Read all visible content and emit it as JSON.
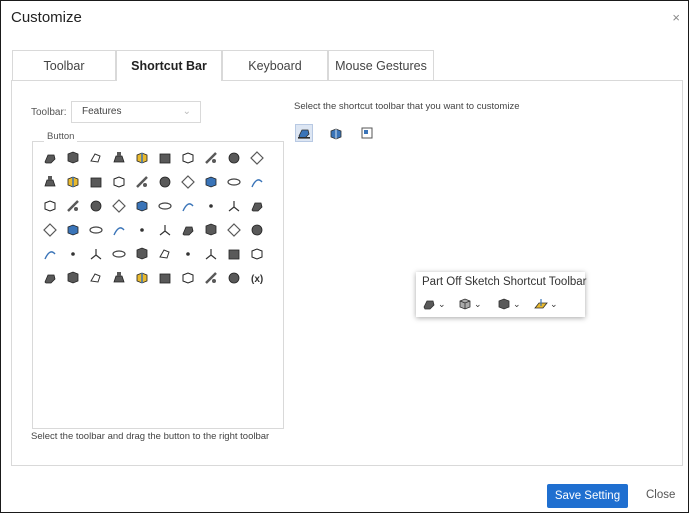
{
  "dialog": {
    "title": "Customize",
    "close_glyph": "×"
  },
  "tabs": [
    {
      "label": "Toolbar",
      "active": false
    },
    {
      "label": "Shortcut Bar",
      "active": true
    },
    {
      "label": "Keyboard",
      "active": false
    },
    {
      "label": "Mouse Gestures",
      "active": false
    }
  ],
  "left": {
    "toolbar_label": "Toolbar:",
    "toolbar_value": "Features",
    "button_group_label": "Button",
    "hint": "Select the toolbar and drag the button to the right toolbar"
  },
  "right": {
    "hint": "Select the shortcut toolbar that you want to customize",
    "shortcut_toolbars": [
      {
        "icon": "part-shortcut-icon",
        "active": true
      },
      {
        "icon": "assembly-shortcut-icon",
        "active": false
      },
      {
        "icon": "drawing-shortcut-icon",
        "active": false
      }
    ],
    "popup": {
      "title": "Part Off Sketch Shortcut Toolbar",
      "items": [
        {
          "icon": "extrude-dropdown-icon"
        },
        {
          "icon": "view-orientation-dropdown-icon"
        },
        {
          "icon": "display-style-dropdown-icon"
        },
        {
          "icon": "plane-dropdown-icon"
        }
      ]
    }
  },
  "icon_rows": [
    [
      "extrude-icon",
      "revolve-icon",
      "sweep-icon",
      "loft-icon",
      "rib-icon",
      "hole-icon",
      "shell-icon",
      "draft-icon",
      "fillet-icon",
      "chamfer-icon"
    ],
    [
      "thread-icon",
      "wrap-icon",
      "emboss-icon",
      "mirror-icon",
      "linear-pattern-icon",
      "circular-pattern-icon",
      "curve-pattern-icon",
      "sketch-pattern-icon",
      "fill-pattern-icon",
      "combine-icon"
    ],
    [
      "move-body-icon",
      "split-icon",
      "intersect-icon",
      "scale-icon",
      "dome-icon",
      "flex-icon",
      "deform-icon",
      "indent-icon",
      "freeform-icon",
      "thicken-icon"
    ],
    [
      "cavity-icon",
      "link-values-icon",
      "cylinder-icon",
      "block-icon",
      "wedge-icon",
      "torus-icon",
      "box-icon",
      "tube-icon",
      "cone-icon",
      "sphere-icon"
    ],
    [
      "reference-plane-icon",
      "pyramid-icon",
      "washer-icon",
      "ellipse-icon",
      "plane-icon",
      "axis-icon",
      "point-icon",
      "coordinate-system-icon",
      "mate-reference-icon",
      "center-of-mass-icon"
    ],
    [
      "curve-through-points-icon",
      "helix-icon",
      "spiral-icon",
      "split-line-icon",
      "composite-curve-icon",
      "projected-curve-icon",
      "offset-curve-icon",
      "cosmetic-thread-icon",
      "surface-icon",
      "equation-icon"
    ]
  ],
  "footer": {
    "save_label": "Save Setting",
    "close_label": "Close"
  },
  "colors": {
    "accent": "#1f6fd0",
    "icon_blue": "#3a74b8",
    "icon_gray": "#595959",
    "icon_yellow": "#e8b92f"
  }
}
